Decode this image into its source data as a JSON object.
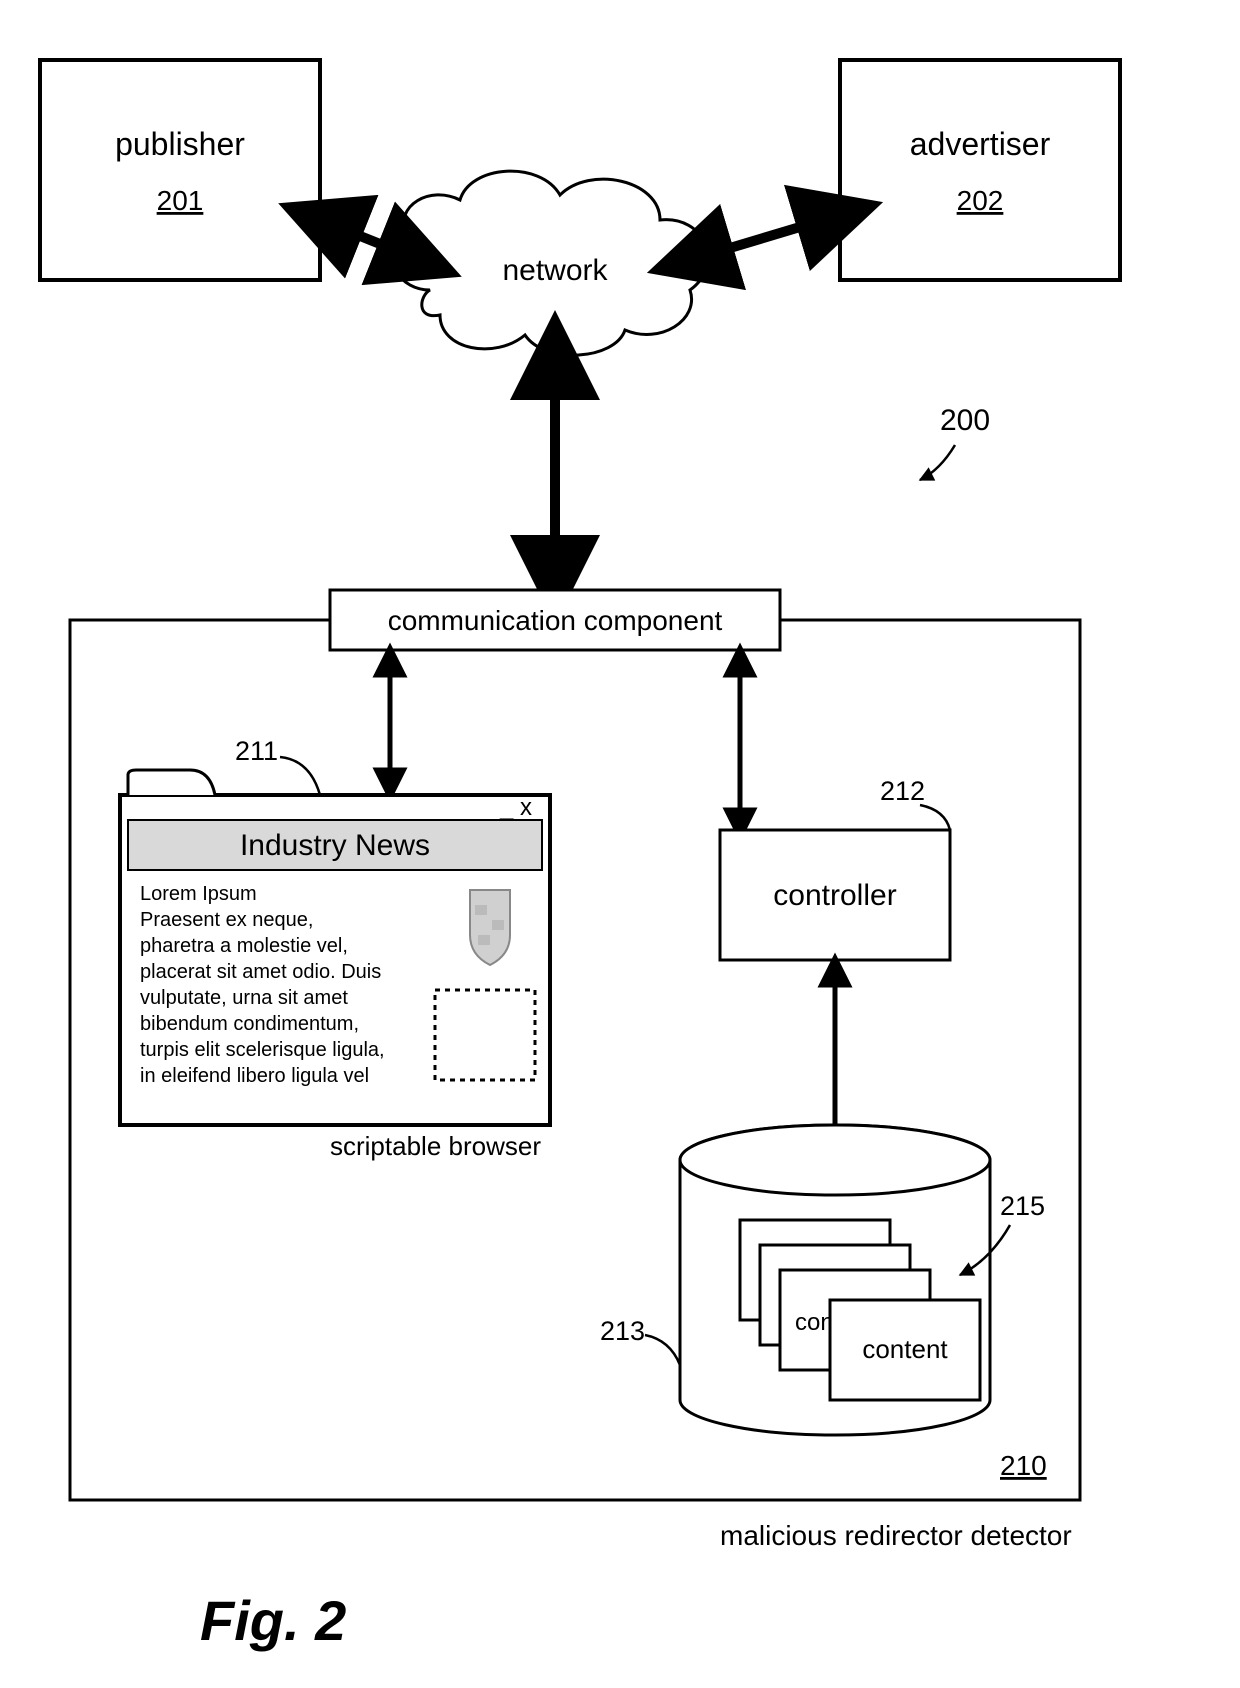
{
  "figure_label": "Fig. 2",
  "system_ref": "200",
  "publisher": {
    "label": "publisher",
    "ref": "201"
  },
  "advertiser": {
    "label": "advertiser",
    "ref": "202"
  },
  "network": "network",
  "comm_component": "communication component",
  "detector": {
    "caption": "malicious redirector detector",
    "ref": "210"
  },
  "browser": {
    "caption": "scriptable browser",
    "ref": "211",
    "window_controls": "_ x",
    "title": "Industry News",
    "body_lines": [
      "Lorem Ipsum",
      "Praesent ex neque,",
      "pharetra a molestie vel,",
      "placerat sit amet odio. Duis",
      "vulputate, urna sit amet",
      "bibendum condimentum,",
      "turpis elit scelerisque ligula,",
      "in eleifend libero ligula vel"
    ]
  },
  "controller": {
    "label": "controller",
    "ref": "212"
  },
  "datastore": {
    "ref": "213",
    "content_ref": "215",
    "card_back": "con",
    "card_front": "content"
  }
}
